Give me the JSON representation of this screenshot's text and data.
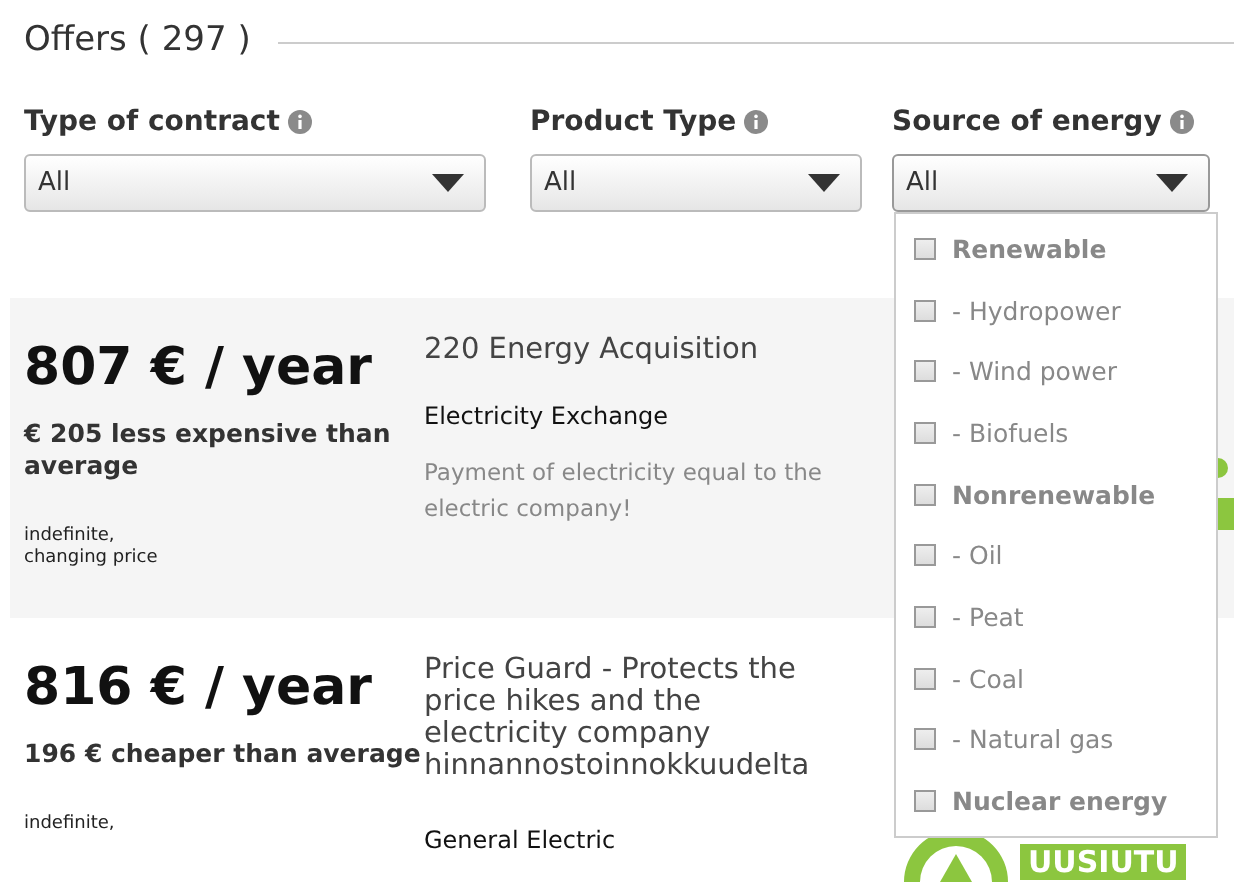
{
  "heading": "Offers ( 297 )",
  "filters": [
    {
      "label": "Type of contract",
      "value": "All",
      "expanded": false
    },
    {
      "label": "Product Type",
      "value": "All",
      "expanded": false
    },
    {
      "label": "Source of energy",
      "value": "All",
      "expanded": true
    }
  ],
  "energy_options": [
    {
      "label": "Renewable",
      "kind": "group",
      "checked": false
    },
    {
      "label": "- Hydropower",
      "kind": "sub",
      "checked": false
    },
    {
      "label": "- Wind power",
      "kind": "sub",
      "checked": false
    },
    {
      "label": "- Biofuels",
      "kind": "sub",
      "checked": false
    },
    {
      "label": "Nonrenewable",
      "kind": "group",
      "checked": false
    },
    {
      "label": "- Oil",
      "kind": "sub",
      "checked": false
    },
    {
      "label": "- Peat",
      "kind": "sub",
      "checked": false
    },
    {
      "label": "- Coal",
      "kind": "sub",
      "checked": false
    },
    {
      "label": "- Natural gas",
      "kind": "sub",
      "checked": false
    },
    {
      "label": "Nuclear energy",
      "kind": "group",
      "checked": false
    }
  ],
  "offers": [
    {
      "price": "807 € / year",
      "saving": "€ 205 less expensive than average",
      "terms": "indefinite,\nchanging price",
      "name": "220 Energy Acquisition",
      "company": "Electricity Exchange",
      "note": "Payment of electricity equal to the electric company!",
      "highlighted": true
    },
    {
      "price": "816 € / year",
      "saving": "196 € cheaper than average",
      "terms": "indefinite,",
      "name": "Price Guard - Protects the price hikes and the electricity company hinnannostoinnokkuudelta",
      "company": "General Electric",
      "highlighted": false,
      "badge": "UUSIUTU"
    }
  ]
}
